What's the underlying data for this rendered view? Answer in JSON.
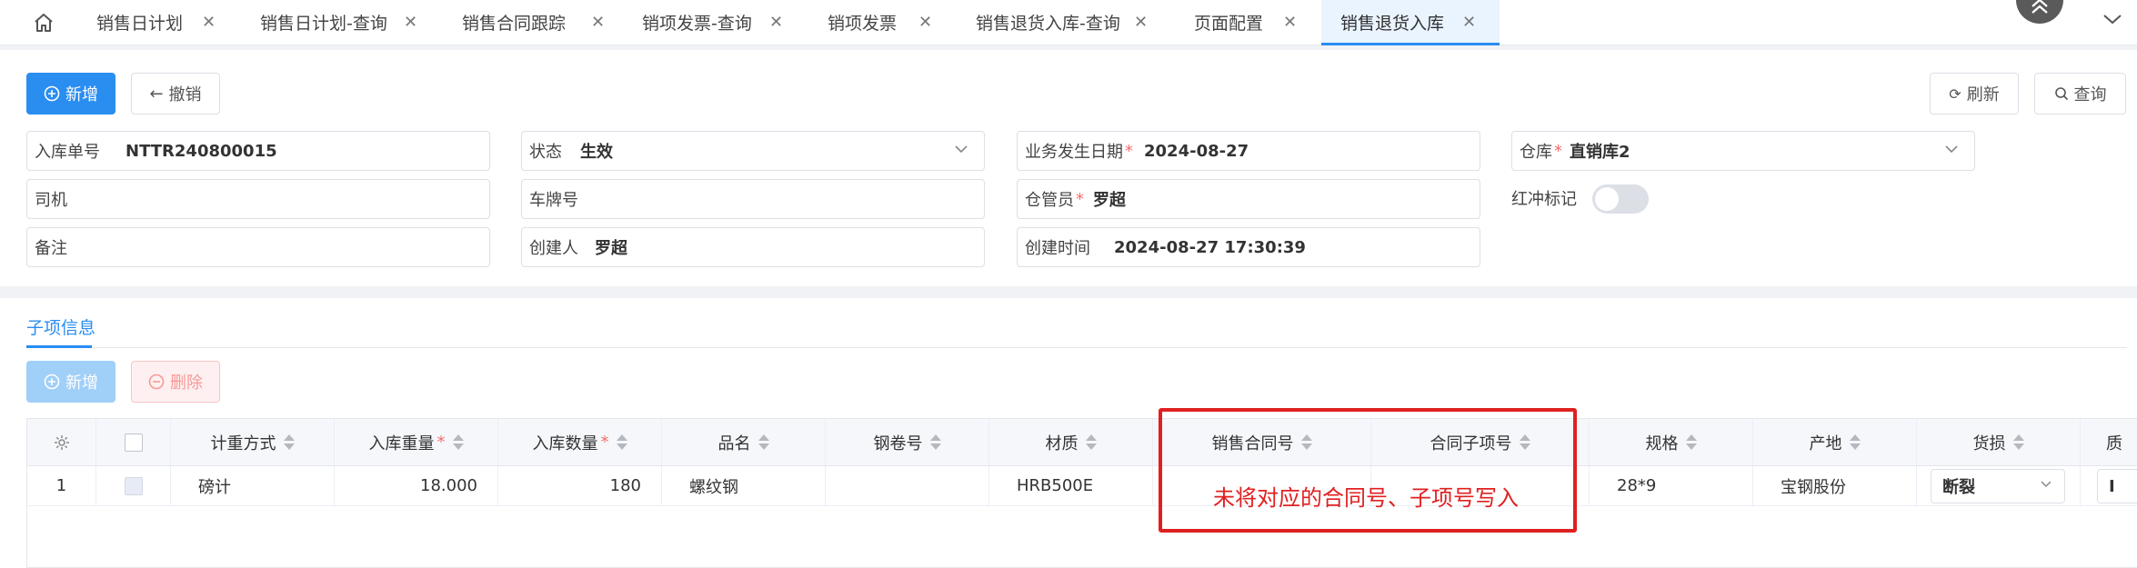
{
  "tabs": [
    {
      "label": "销售日计划"
    },
    {
      "label": "销售日计划-查询"
    },
    {
      "label": "销售合同跟踪"
    },
    {
      "label": "销项发票-查询"
    },
    {
      "label": "销项发票"
    },
    {
      "label": "销售退货入库-查询"
    },
    {
      "label": "页面配置"
    },
    {
      "label": "销售退货入库"
    }
  ],
  "toolbar": {
    "add": "新增",
    "revoke": "撤销",
    "refresh": "刷新",
    "query": "查询"
  },
  "form": {
    "receipt_no": {
      "label": "入库单号",
      "value": "NTTR240800015"
    },
    "status": {
      "label": "状态",
      "value": "生效"
    },
    "biz_date": {
      "label": "业务发生日期",
      "value": "2024-08-27"
    },
    "warehouse": {
      "label": "仓库",
      "value": "直销库2"
    },
    "driver": {
      "label": "司机",
      "value": ""
    },
    "plate": {
      "label": "车牌号",
      "value": ""
    },
    "keeper": {
      "label": "仓管员",
      "value": "罗超"
    },
    "red_flag": {
      "label": "红冲标记",
      "checked": false
    },
    "remark": {
      "label": "备注",
      "value": ""
    },
    "creator": {
      "label": "创建人",
      "value": "罗超"
    },
    "created_at": {
      "label": "创建时间",
      "value": "2024-08-27 17:30:39"
    }
  },
  "sub": {
    "tab_label": "子项信息",
    "add": "新增",
    "delete": "删除",
    "columns": [
      "计重方式",
      "入库重量",
      "入库数量",
      "品名",
      "钢卷号",
      "材质",
      "销售合同号",
      "合同子项号",
      "规格",
      "产地",
      "货损",
      "质"
    ],
    "rows": [
      {
        "index": "1",
        "weigh_method": "磅计",
        "weight": "18.000",
        "qty": "180",
        "product": "螺纹钢",
        "coil_no": "",
        "material": "HRB500E",
        "contract_no": "",
        "contract_item": "",
        "spec": "28*9",
        "origin": "宝钢股份",
        "damage": "断裂",
        "extra": "I"
      }
    ]
  },
  "annotation": "未将对应的合同号、子项号写入",
  "colors": {
    "primary": "#2a8df0",
    "required": "#f56c6c",
    "annotation": "#e02020"
  }
}
